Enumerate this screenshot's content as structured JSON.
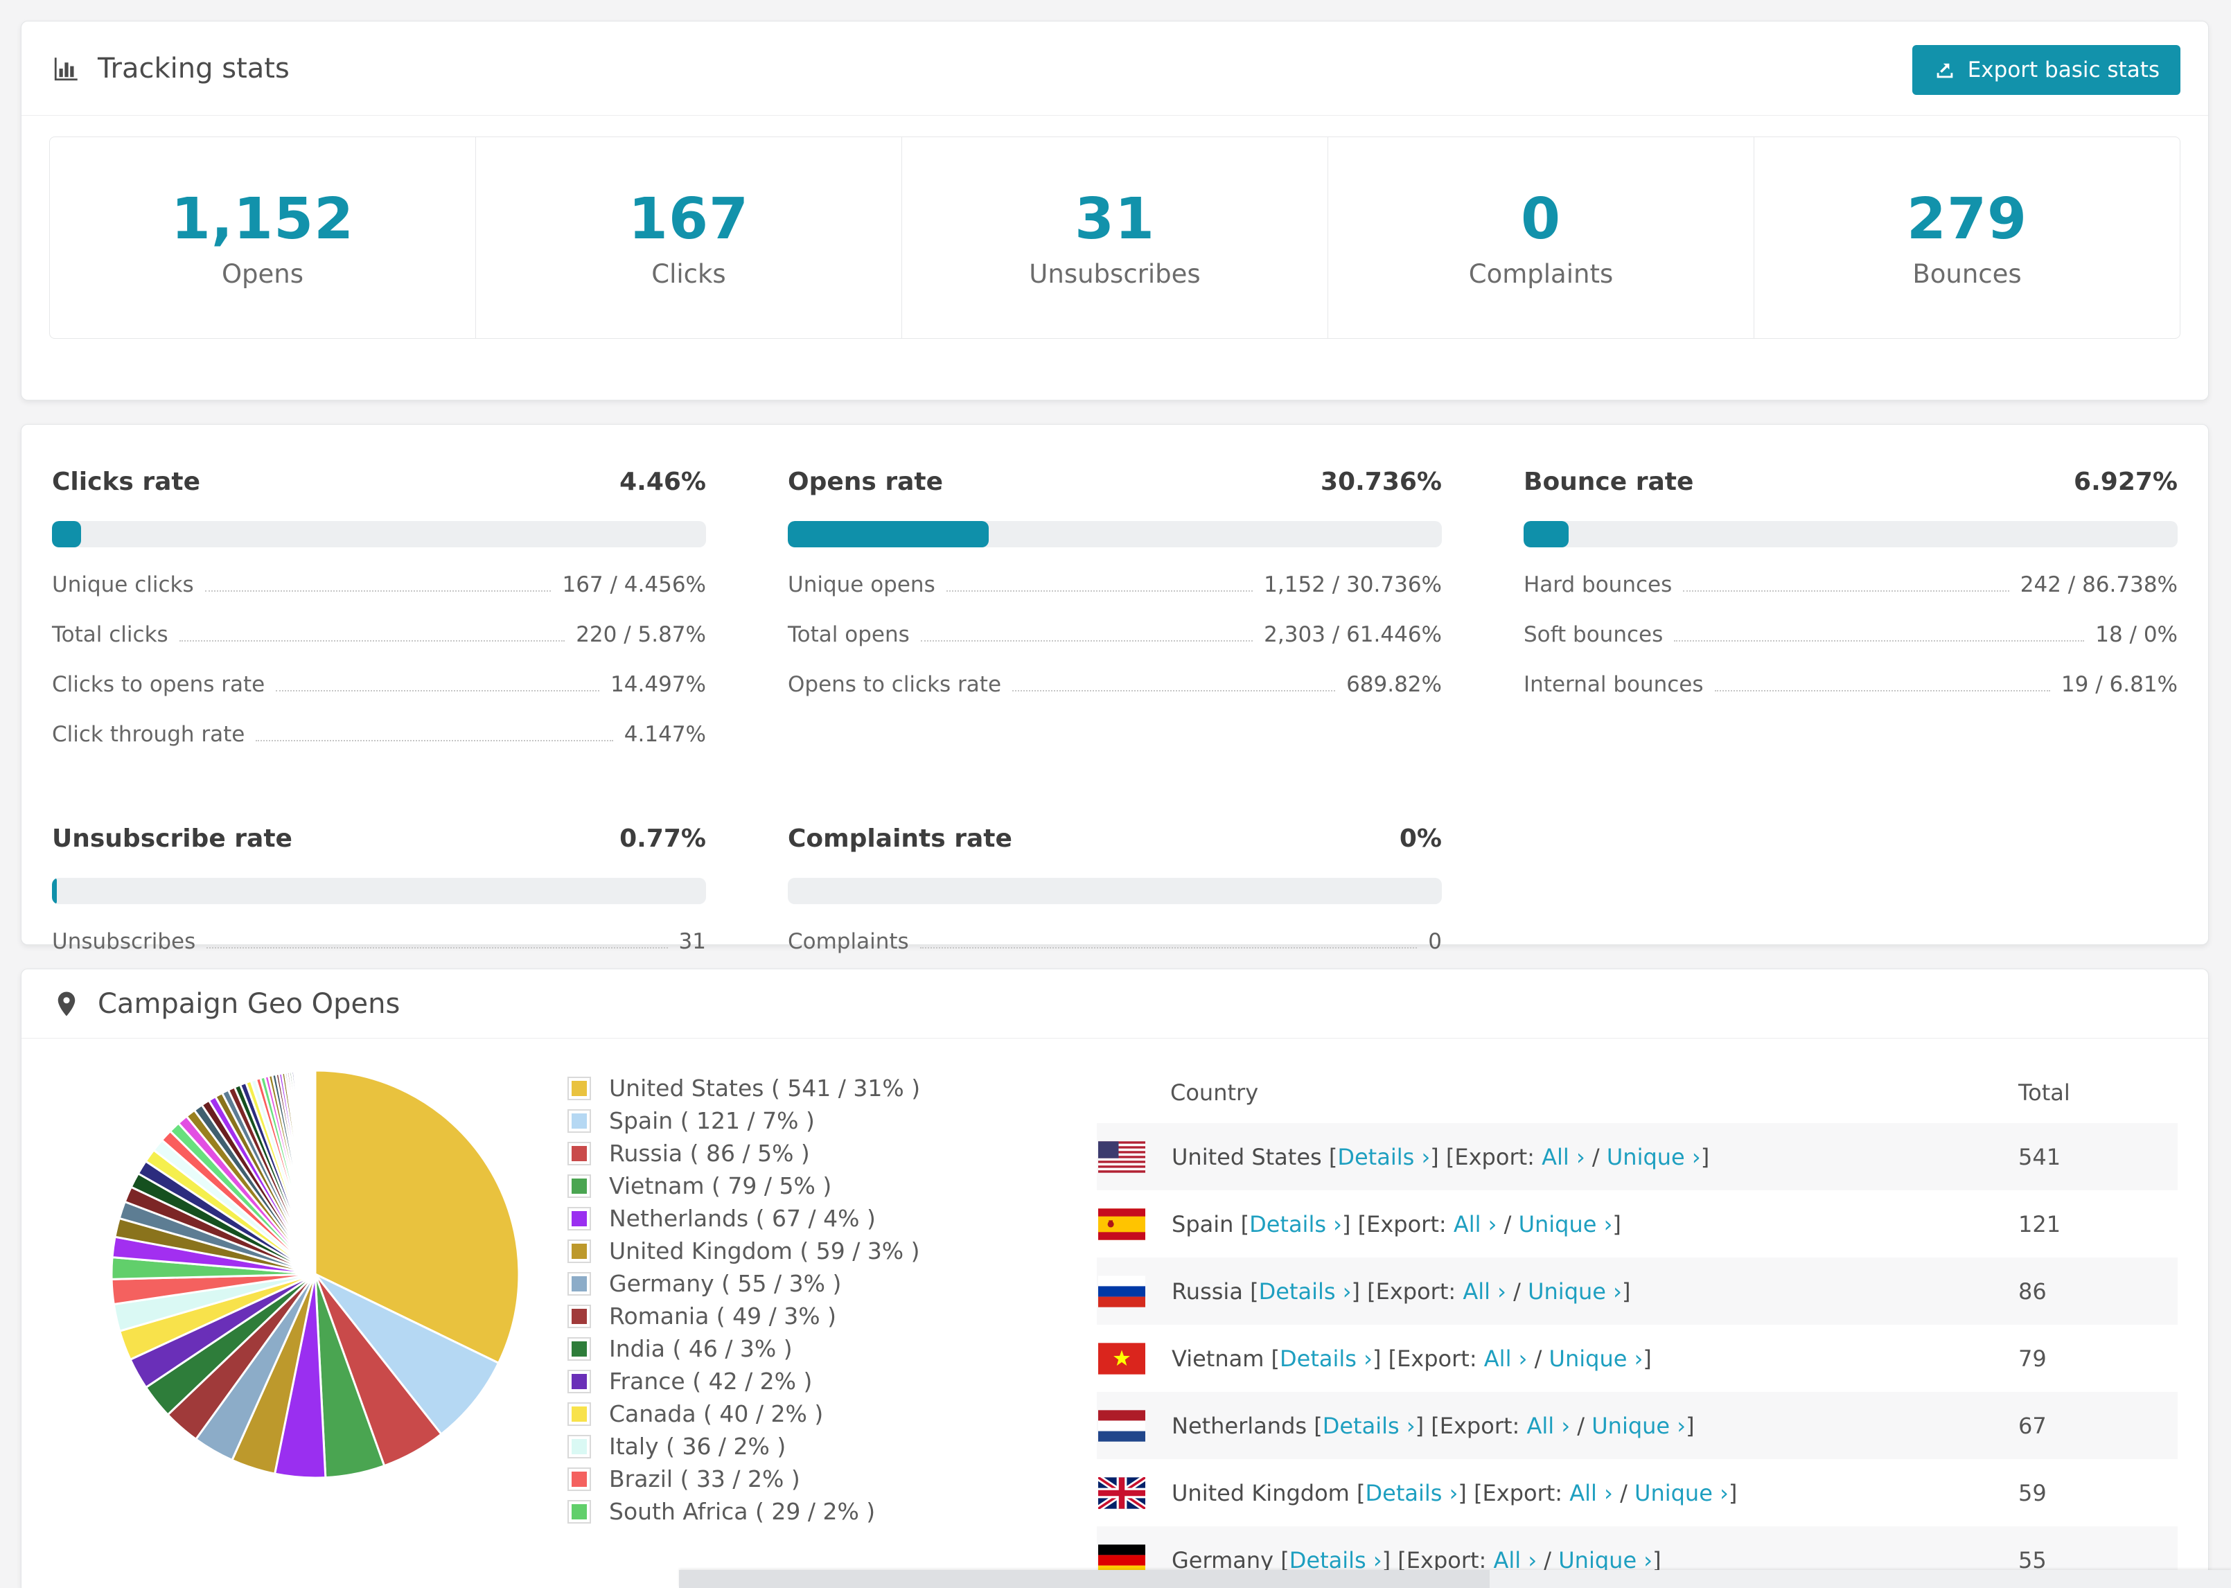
{
  "tracking": {
    "title": "Tracking stats",
    "export_label": "Export basic stats",
    "summary": [
      {
        "value": "1,152",
        "label": "Opens"
      },
      {
        "value": "167",
        "label": "Clicks"
      },
      {
        "value": "31",
        "label": "Unsubscribes"
      },
      {
        "value": "0",
        "label": "Complaints"
      },
      {
        "value": "279",
        "label": "Bounces"
      }
    ]
  },
  "rates": [
    {
      "title": "Clicks rate",
      "value": "4.46%",
      "pct": 4.46,
      "rows": [
        {
          "label": "Unique clicks",
          "value": "167 / 4.456%"
        },
        {
          "label": "Total clicks",
          "value": "220 / 5.87%"
        },
        {
          "label": "Clicks to opens rate",
          "value": "14.497%"
        },
        {
          "label": "Click through rate",
          "value": "4.147%"
        }
      ]
    },
    {
      "title": "Opens rate",
      "value": "30.736%",
      "pct": 30.736,
      "rows": [
        {
          "label": "Unique opens",
          "value": "1,152 / 30.736%"
        },
        {
          "label": "Total opens",
          "value": "2,303 / 61.446%"
        },
        {
          "label": "Opens to clicks rate",
          "value": "689.82%"
        }
      ]
    },
    {
      "title": "Bounce rate",
      "value": "6.927%",
      "pct": 6.927,
      "rows": [
        {
          "label": "Hard bounces",
          "value": "242 / 86.738%"
        },
        {
          "label": "Soft bounces",
          "value": "18 / 0%"
        },
        {
          "label": "Internal bounces",
          "value": "19 / 6.81%"
        }
      ]
    },
    {
      "title": "Unsubscribe rate",
      "value": "0.77%",
      "pct": 0.77,
      "rows": [
        {
          "label": "Unsubscribes",
          "value": "31"
        }
      ]
    },
    {
      "title": "Complaints rate",
      "value": "0%",
      "pct": 0,
      "rows": [
        {
          "label": "Complaints",
          "value": "0"
        }
      ]
    }
  ],
  "geo": {
    "title": "Campaign Geo Opens",
    "legend": [
      {
        "name": "United States",
        "text": "United States ( 541 / 31% )",
        "value": 541,
        "color": "#e9c23e"
      },
      {
        "name": "Spain",
        "text": "Spain ( 121 / 7% )",
        "value": 121,
        "color": "#b5d8f3"
      },
      {
        "name": "Russia",
        "text": "Russia ( 86 / 5% )",
        "value": 86,
        "color": "#c94a4a"
      },
      {
        "name": "Vietnam",
        "text": "Vietnam ( 79 / 5% )",
        "value": 79,
        "color": "#4aa551"
      },
      {
        "name": "Netherlands",
        "text": "Netherlands ( 67 / 4% )",
        "value": 67,
        "color": "#9a2ff0"
      },
      {
        "name": "United Kingdom",
        "text": "United Kingdom ( 59 / 3% )",
        "value": 59,
        "color": "#bd992c"
      },
      {
        "name": "Germany",
        "text": "Germany ( 55 / 3% )",
        "value": 55,
        "color": "#8cacc8"
      },
      {
        "name": "Romania",
        "text": "Romania ( 49 / 3% )",
        "value": 49,
        "color": "#a03a3a"
      },
      {
        "name": "India",
        "text": "India ( 46 / 3% )",
        "value": 46,
        "color": "#2e7d3a"
      },
      {
        "name": "France",
        "text": "France ( 42 / 2% )",
        "value": 42,
        "color": "#6a2fb8"
      },
      {
        "name": "Canada",
        "text": "Canada ( 40 / 2% )",
        "value": 40,
        "color": "#f8e24b"
      },
      {
        "name": "Italy",
        "text": "Italy ( 36 / 2% )",
        "value": 36,
        "color": "#daf9f4"
      },
      {
        "name": "Brazil",
        "text": "Brazil ( 33 / 2% )",
        "value": 33,
        "color": "#f4615f"
      },
      {
        "name": "South Africa",
        "text": "South Africa ( 29 / 2% )",
        "value": 29,
        "color": "#61cf6b"
      }
    ],
    "pie_tail_values": [
      27,
      25,
      23,
      21,
      20,
      19,
      18,
      17,
      16,
      15,
      14,
      13,
      12,
      11,
      10,
      10,
      9,
      9,
      8,
      8,
      7,
      7,
      6,
      6,
      5,
      5,
      5,
      4,
      4,
      4,
      3,
      3,
      3,
      3,
      2,
      2,
      2,
      2,
      2,
      2,
      1,
      1,
      1,
      1,
      1,
      1,
      1,
      1,
      1,
      1,
      1,
      1,
      1,
      1,
      1,
      1
    ],
    "pie_tail_colors": [
      "#a22ff0",
      "#8a731c",
      "#5d7d93",
      "#7c2626",
      "#15501f",
      "#2c2c7e",
      "#f5ef4e",
      "#e9fdfb",
      "#fa5d5d",
      "#68e07e",
      "#e24fe2",
      "#99801f",
      "#40606f",
      "#6a1f1f"
    ],
    "table": {
      "columns": [
        "Country",
        "Total"
      ],
      "link_details": "Details ›",
      "link_all": "All ›",
      "link_unique": "Unique ›",
      "seg_open": " [",
      "seg_mid": "] [",
      "seg_export": "Export: ",
      "seg_slash": " / ",
      "seg_close": "]",
      "rows": [
        {
          "country": "United States",
          "flag": "us",
          "total": "541"
        },
        {
          "country": "Spain",
          "flag": "es",
          "total": "121"
        },
        {
          "country": "Russia",
          "flag": "ru",
          "total": "86"
        },
        {
          "country": "Vietnam",
          "flag": "vn",
          "total": "79"
        },
        {
          "country": "Netherlands",
          "flag": "nl",
          "total": "67"
        },
        {
          "country": "United Kingdom",
          "flag": "gb",
          "total": "59"
        },
        {
          "country": "Germany",
          "flag": "de",
          "total": "55"
        }
      ]
    }
  },
  "colors": {
    "accent_teal": "#1292ab",
    "bar_fill": "#0f90aa",
    "link_teal": "#1e9fc0",
    "row_alt_bg": "#f7f7f8"
  }
}
